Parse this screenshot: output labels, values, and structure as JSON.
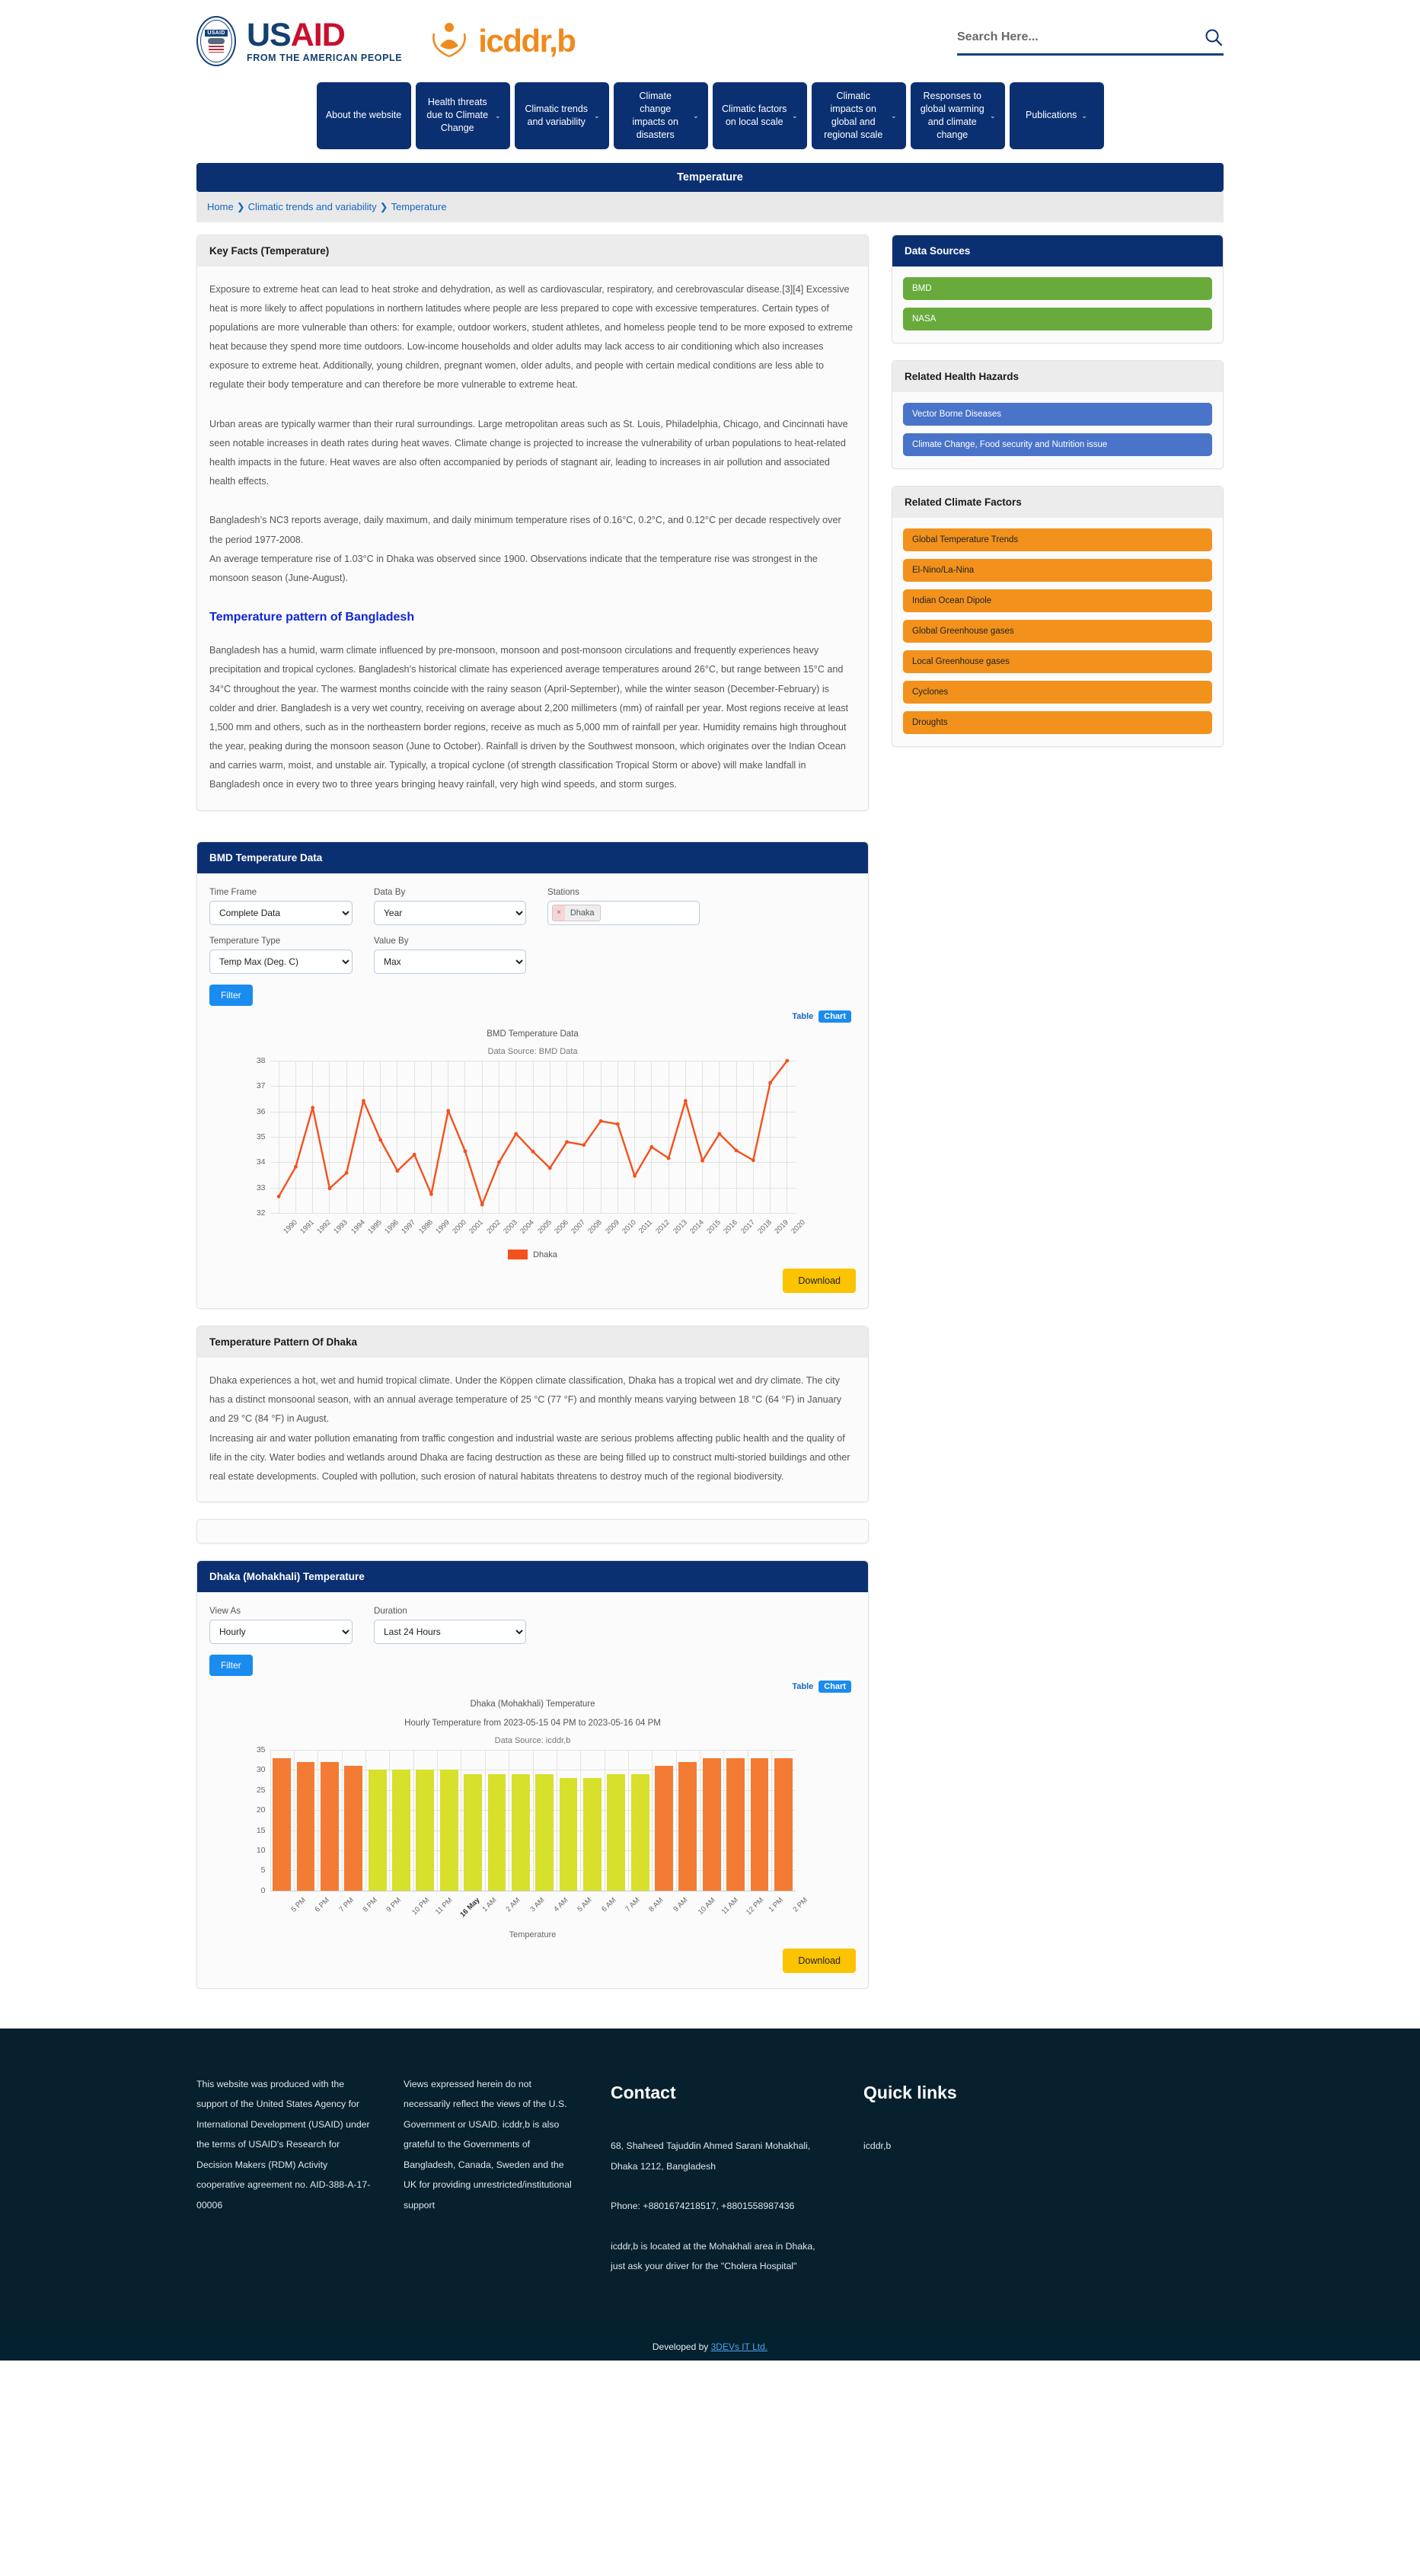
{
  "header": {
    "usaid_big_us": "US",
    "usaid_big_aid": "AID",
    "usaid_seal_tag": "USAID",
    "usaid_tagline": "FROM THE AMERICAN PEOPLE",
    "icddrb_word": "icddr,b",
    "search_placeholder": "Search Here...",
    "search_value": ""
  },
  "nav": {
    "items": [
      {
        "label": "About the website",
        "caret": ""
      },
      {
        "label": "Health threats due to Climate Change",
        "caret": "⌄"
      },
      {
        "label": "Climatic trends and variability",
        "caret": "⌄"
      },
      {
        "label": "Climate change impacts on disasters",
        "caret": "⌄"
      },
      {
        "label": "Climatic factors on local scale",
        "caret": "⌄"
      },
      {
        "label": "Climatic impacts on global and regional scale",
        "caret": "⌄"
      },
      {
        "label": "Responses to global warming and climate change",
        "caret": "⌄"
      },
      {
        "label": "Publications",
        "caret": "⌄"
      }
    ]
  },
  "page": {
    "title": "Temperature",
    "breadcrumb": {
      "home": "Home",
      "parent": "Climatic trends and variability",
      "current": "Temperature",
      "separator": "❯"
    }
  },
  "key_facts": {
    "heading": "Key Facts (Temperature)",
    "paragraphs": [
      "Exposure to extreme heat can lead to heat stroke and dehydration, as well as cardiovascular, respiratory, and cerebrovascular disease.[3][4] Excessive heat is more likely to affect populations in northern latitudes where people are less prepared to cope with excessive temperatures. Certain types of populations are more vulnerable than others: for example, outdoor workers, student athletes, and homeless people tend to be more exposed to extreme heat because they spend more time outdoors. Low-income households and older adults may lack access to air conditioning which also increases exposure to extreme heat. Additionally, young children, pregnant women, older adults, and people with certain medical conditions are less able to regulate their body temperature and can therefore be more vulnerable to extreme heat.",
      "Urban areas are typically warmer than their rural surroundings. Large metropolitan areas such as St. Louis, Philadelphia, Chicago, and Cincinnati have seen notable increases in death rates during heat waves. Climate change is projected to increase the vulnerability of urban populations to heat-related health impacts in the future. Heat waves are also often accompanied by periods of stagnant air, leading to increases in air pollution and associated health effects.",
      "Bangladesh’s NC3 reports average, daily maximum, and daily minimum temperature rises of 0.16°C, 0.2°C, and 0.12°C per decade respectively over the period 1977-2008.\nAn average temperature rise of 1.03°C in Dhaka was observed since 1900. Observations indicate that the temperature rise was strongest in the monsoon season (June-August)."
    ],
    "subheading": "Temperature pattern of Bangladesh",
    "subparagraph": "Bangladesh has a humid, warm climate influenced by pre-monsoon, monsoon and post-monsoon circulations and frequently experiences heavy precipitation and tropical cyclones. Bangladesh’s historical climate has experienced average temperatures around 26°C, but range between 15°C and 34°C throughout the year. The warmest months coincide with the rainy season (April-September), while the winter season (December-February) is colder and drier. Bangladesh is a very wet country, receiving on average about 2,200 millimeters (mm) of rainfall per year. Most regions receive at least 1,500 mm and others, such as in the northeastern border regions, receive as much as 5,000 mm of rainfall per year. Humidity remains high throughout the year, peaking during the monsoon season (June to October). Rainfall is driven by the Southwest monsoon, which originates over the Indian Ocean and carries warm, moist, and unstable air. Typically, a tropical cyclone (of strength classification Tropical Storm or above) will make landfall in Bangladesh once in every two to three years bringing heavy rainfall, very high wind speeds, and storm surges."
  },
  "sidebar": {
    "data_sources": {
      "title": "Data Sources",
      "items": [
        "BMD",
        "NASA"
      ]
    },
    "health_hazards": {
      "title": "Related Health Hazards",
      "items": [
        "Vector Borne Diseases",
        "Climate Change, Food security and Nutrition issue"
      ]
    },
    "climate_factors": {
      "title": "Related Climate Factors",
      "items": [
        "Global Temperature Trends",
        "El-Nino/La-Nina",
        "Indian Ocean Dipole",
        "Global Greenhouse gases",
        "Local Greenhouse gases",
        "Cyclones",
        "Droughts"
      ]
    }
  },
  "bmd_panel": {
    "title": "BMD Temperature Data",
    "fields": {
      "time_frame_label": "Time Frame",
      "time_frame_value": "Complete Data",
      "temperature_type_label": "Temperature Type",
      "temperature_type_value": "Temp Max (Deg. C)",
      "data_by_label": "Data By",
      "data_by_value": "Year",
      "value_by_label": "Value By",
      "value_by_value": "Max",
      "stations_label": "Stations",
      "station_token": "Dhaka",
      "station_remove": "×"
    },
    "filter_button": "Filter",
    "download_button": "Download",
    "tab_table": "Table",
    "tab_chart": "Chart"
  },
  "dhaka_pattern": {
    "heading": "Temperature Pattern Of Dhaka",
    "paragraph": "Dhaka experiences a hot, wet and humid tropical climate. Under the Köppen climate classification, Dhaka has a tropical wet and dry climate. The city has a distinct monsoonal season, with an annual average temperature of 25 °C (77 °F) and monthly means varying between 18 °C (64 °F) in January and 29 °C (84 °F) in August.\nIncreasing air and water pollution emanating from traffic congestion and industrial waste are serious problems affecting public health and the quality of life in the city. Water bodies and wetlands around Dhaka are facing destruction as these are being filled up to construct multi-storied buildings and other real estate developments. Coupled with pollution, such erosion of natural habitats threatens to destroy much of the regional biodiversity."
  },
  "mohakhali_panel": {
    "title": "Dhaka (Mohakhali) Temperature",
    "fields": {
      "view_as_label": "View As",
      "view_as_value": "Hourly",
      "duration_label": "Duration",
      "duration_value": "Last 24 Hours"
    },
    "filter_button": "Filter",
    "download_button": "Download",
    "tab_table": "Table",
    "tab_chart": "Chart"
  },
  "chart_data": [
    {
      "id": "bmd-line",
      "type": "line",
      "title": "BMD Temperature Data",
      "subtitle": "Data Source: BMD Data",
      "xlabel": "",
      "ylabel": "",
      "ylim": [
        32,
        38
      ],
      "yticks": [
        32,
        33,
        34,
        35,
        36,
        37,
        38
      ],
      "grid": true,
      "legend": [
        "Dhaka"
      ],
      "legend_position": "bottom",
      "series_color": "#f4511e",
      "categories": [
        "1990",
        "1991",
        "1992",
        "1993",
        "1994",
        "1995",
        "1996",
        "1997",
        "1998",
        "1999",
        "2000",
        "2001",
        "2002",
        "2003",
        "2004",
        "2005",
        "2006",
        "2007",
        "2008",
        "2009",
        "2010",
        "2011",
        "2012",
        "2013",
        "2014",
        "2015",
        "2016",
        "2017",
        "2018",
        "2019",
        "2020"
      ],
      "series": [
        {
          "name": "Dhaka",
          "values": [
            32.65,
            33.82,
            36.15,
            32.97,
            33.58,
            36.42,
            34.88,
            33.66,
            34.3,
            32.74,
            36.03,
            34.43,
            32.33,
            34.0,
            35.12,
            34.42,
            33.77,
            34.8,
            34.68,
            35.62,
            35.5,
            33.46,
            34.6,
            34.16,
            36.42,
            34.06,
            35.12,
            34.46,
            34.08,
            37.13,
            38.0
          ]
        }
      ]
    },
    {
      "id": "mohakhali-bar",
      "type": "bar",
      "title": "Dhaka (Mohakhali) Temperature",
      "subtitle": "Hourly Temperature from 2023-05-15 04 PM to 2023-05-16 04 PM",
      "source": "Data Source: icddr,b",
      "xlabel": "Temperature",
      "ylabel": "",
      "ylim": [
        0,
        35
      ],
      "yticks": [
        0,
        5,
        10,
        15,
        20,
        25,
        30,
        35
      ],
      "grid": true,
      "colors": {
        "day": "#f47b33",
        "night": "#d7e02a"
      },
      "categories": [
        "5 PM",
        "6 PM",
        "7 PM",
        "8 PM",
        "9 PM",
        "10 PM",
        "11 PM",
        "16 May",
        "1 AM",
        "2 AM",
        "3 AM",
        "4 AM",
        "5 AM",
        "6 AM",
        "7 AM",
        "8 AM",
        "9 AM",
        "10 AM",
        "11 AM",
        "12 PM",
        "1 PM",
        "2 PM"
      ],
      "values": [
        33,
        32,
        32,
        31,
        30,
        30,
        30,
        30,
        29,
        29,
        29,
        29,
        28,
        28,
        29,
        29,
        31,
        32,
        33,
        33,
        33,
        33
      ],
      "bar_colors": [
        "day",
        "day",
        "day",
        "day",
        "night",
        "night",
        "night",
        "night",
        "night",
        "night",
        "night",
        "night",
        "night",
        "night",
        "night",
        "night",
        "day",
        "day",
        "day",
        "day",
        "day",
        "day"
      ],
      "bold_categories": [
        "16 May"
      ]
    }
  ],
  "footer": {
    "col1": "This website was produced with the support of the United States Agency for International Development (USAID) under the terms of USAID's Research for Decision Makers (RDM) Activity cooperative agreement no. AID-388-A-17-00006",
    "col2": "Views expressed herein do not necessarily reflect the views of the U.S. Government or USAID. icddr,b is also grateful to the Governments of Bangladesh, Canada, Sweden and the UK for providing unrestricted/institutional support",
    "contact_heading": "Contact",
    "contact_address": "68, Shaheed Tajuddin Ahmed Sarani Mohakhali, Dhaka 1212, Bangladesh",
    "contact_phone": "Phone: +8801674218517, +8801558987436",
    "contact_note": "icddr,b is located at the Mohakhali area in Dhaka, just ask your driver for the \"Cholera Hospital\"",
    "quick_links_heading": "Quick links",
    "quick_links": [
      "icddr,b"
    ],
    "credit_prefix": "Developed by ",
    "credit_link": "3DEVs IT Ltd."
  }
}
